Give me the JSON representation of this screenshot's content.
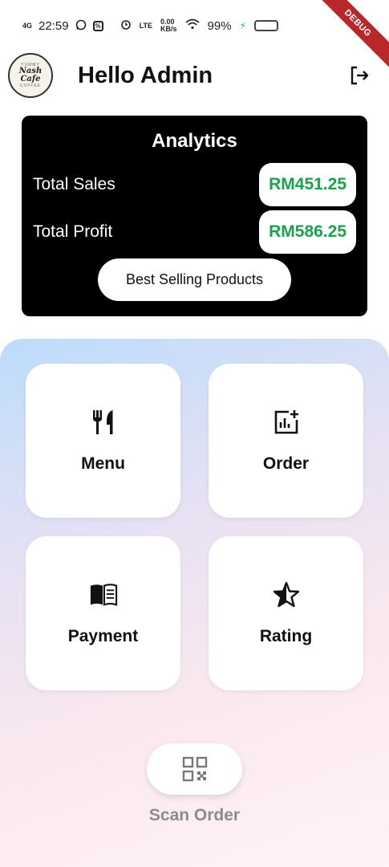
{
  "status_bar": {
    "network": "4G",
    "time": "22:59",
    "data_speed": "0.00",
    "data_unit": "KB/s",
    "network_right": "LTE",
    "battery": "99%"
  },
  "debug_banner": "DEBUG",
  "header": {
    "logo": {
      "top": "YUMMY",
      "name": "Nash Cafe",
      "bottom": "COFFEE"
    },
    "greeting": "Hello Admin"
  },
  "analytics": {
    "title": "Analytics",
    "total_sales_label": "Total Sales",
    "total_sales_value": "RM451.25",
    "total_profit_label": "Total Profit",
    "total_profit_value": "RM586.25",
    "best_selling_button": "Best Selling Products"
  },
  "tiles": [
    {
      "label": "Menu",
      "icon": "fork-knife-icon"
    },
    {
      "label": "Order",
      "icon": "chart-add-icon"
    },
    {
      "label": "Payment",
      "icon": "book-icon"
    },
    {
      "label": "Rating",
      "icon": "star-icon"
    }
  ],
  "scan": {
    "label": "Scan Order",
    "icon": "qr-code-icon"
  },
  "colors": {
    "accent_green": "#1aa34a",
    "card_black": "#000000",
    "debug_red": "#b8272a"
  }
}
